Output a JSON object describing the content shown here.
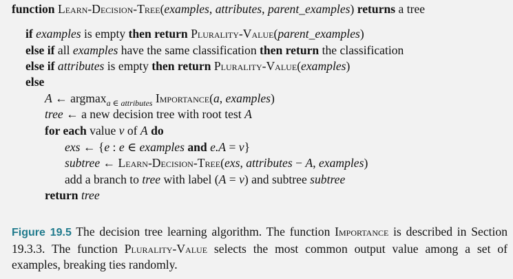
{
  "algorithm": {
    "lines": [
      {
        "indent": 0,
        "parts": [
          {
            "t": "function ",
            "s": "b"
          },
          {
            "t": "Learn-Decision-Tree",
            "s": "sc"
          },
          {
            "t": "(",
            "s": ""
          },
          {
            "t": "examples",
            "s": "i"
          },
          {
            "t": ", ",
            "s": ""
          },
          {
            "t": "attributes",
            "s": "i"
          },
          {
            "t": ", ",
            "s": ""
          },
          {
            "t": "parent_examples",
            "s": "i"
          },
          {
            "t": ") ",
            "s": ""
          },
          {
            "t": "returns",
            "s": "b"
          },
          {
            "t": " a tree",
            "s": ""
          }
        ]
      },
      {
        "indent": 1,
        "parts": [
          {
            "t": "if ",
            "s": "b"
          },
          {
            "t": "examples",
            "s": "i"
          },
          {
            "t": " is empty ",
            "s": ""
          },
          {
            "t": "then return ",
            "s": "b"
          },
          {
            "t": "Plurality-Value",
            "s": "sc"
          },
          {
            "t": "(",
            "s": ""
          },
          {
            "t": "parent_examples",
            "s": "i"
          },
          {
            "t": ")",
            "s": ""
          }
        ]
      },
      {
        "indent": 1,
        "parts": [
          {
            "t": "else if",
            "s": "b"
          },
          {
            "t": " all ",
            "s": ""
          },
          {
            "t": "examples",
            "s": "i"
          },
          {
            "t": " have the same classification ",
            "s": ""
          },
          {
            "t": "then return",
            "s": "b"
          },
          {
            "t": " the classification",
            "s": ""
          }
        ]
      },
      {
        "indent": 1,
        "parts": [
          {
            "t": "else if ",
            "s": "b"
          },
          {
            "t": "attributes",
            "s": "i"
          },
          {
            "t": " is empty ",
            "s": ""
          },
          {
            "t": "then return ",
            "s": "b"
          },
          {
            "t": "Plurality-Value",
            "s": "sc"
          },
          {
            "t": "(",
            "s": ""
          },
          {
            "t": "examples",
            "s": "i"
          },
          {
            "t": ")",
            "s": ""
          }
        ]
      },
      {
        "indent": 1,
        "parts": [
          {
            "t": "else",
            "s": "b"
          }
        ]
      },
      {
        "indent": 2,
        "parts": [
          {
            "t": "A",
            "s": "i"
          },
          {
            "t": " ← argmax",
            "s": ""
          },
          {
            "t": "a ∈ attributes",
            "s": "sub"
          },
          {
            "t": " ",
            "s": ""
          },
          {
            "t": "Importance",
            "s": "sc"
          },
          {
            "t": "(",
            "s": ""
          },
          {
            "t": "a",
            "s": "i"
          },
          {
            "t": ", ",
            "s": ""
          },
          {
            "t": "examples",
            "s": "i"
          },
          {
            "t": ")",
            "s": ""
          }
        ]
      },
      {
        "indent": 2,
        "parts": [
          {
            "t": "tree",
            "s": "i"
          },
          {
            "t": " ← a new decision tree with root test ",
            "s": ""
          },
          {
            "t": "A",
            "s": "i"
          }
        ]
      },
      {
        "indent": 2,
        "parts": [
          {
            "t": "for each",
            "s": "b"
          },
          {
            "t": " value ",
            "s": ""
          },
          {
            "t": "v",
            "s": "i"
          },
          {
            "t": " of ",
            "s": ""
          },
          {
            "t": "A",
            "s": "i"
          },
          {
            "t": " do",
            "s": "b"
          }
        ]
      },
      {
        "indent": 3,
        "parts": [
          {
            "t": "exs",
            "s": "i"
          },
          {
            "t": " ← {",
            "s": ""
          },
          {
            "t": "e",
            "s": "i"
          },
          {
            "t": " : ",
            "s": ""
          },
          {
            "t": "e",
            "s": "i"
          },
          {
            "t": " ∈ ",
            "s": ""
          },
          {
            "t": "examples",
            "s": "i"
          },
          {
            "t": " and ",
            "s": "b"
          },
          {
            "t": "e.A",
            "s": "i"
          },
          {
            "t": " = ",
            "s": ""
          },
          {
            "t": "v",
            "s": "i"
          },
          {
            "t": "}",
            "s": ""
          }
        ]
      },
      {
        "indent": 3,
        "parts": [
          {
            "t": "subtree",
            "s": "i"
          },
          {
            "t": " ← ",
            "s": ""
          },
          {
            "t": "Learn-Decision-Tree",
            "s": "sc"
          },
          {
            "t": "(",
            "s": ""
          },
          {
            "t": "exs",
            "s": "i"
          },
          {
            "t": ", ",
            "s": ""
          },
          {
            "t": "attributes",
            "s": "i"
          },
          {
            "t": " − ",
            "s": ""
          },
          {
            "t": "A",
            "s": "i"
          },
          {
            "t": ", ",
            "s": ""
          },
          {
            "t": "examples",
            "s": "i"
          },
          {
            "t": ")",
            "s": ""
          }
        ]
      },
      {
        "indent": 3,
        "parts": [
          {
            "t": "add a branch to ",
            "s": ""
          },
          {
            "t": "tree",
            "s": "i"
          },
          {
            "t": " with label (",
            "s": ""
          },
          {
            "t": "A",
            "s": "i"
          },
          {
            "t": " = ",
            "s": ""
          },
          {
            "t": "v",
            "s": "i"
          },
          {
            "t": ") and subtree ",
            "s": ""
          },
          {
            "t": "subtree",
            "s": "i"
          }
        ]
      },
      {
        "indent": 2,
        "parts": [
          {
            "t": "return ",
            "s": "b"
          },
          {
            "t": "tree",
            "s": "i"
          }
        ]
      }
    ]
  },
  "caption": {
    "label": "Figure 19.5",
    "parts": [
      {
        "t": " The decision tree learning algorithm. The function ",
        "s": ""
      },
      {
        "t": "Importance",
        "s": "sc"
      },
      {
        "t": " is described in Section 19.3.3. The function ",
        "s": ""
      },
      {
        "t": "Plurality-Value",
        "s": "sc"
      },
      {
        "t": " selects the most common output value among a set of examples, breaking ties randomly.",
        "s": ""
      }
    ]
  }
}
